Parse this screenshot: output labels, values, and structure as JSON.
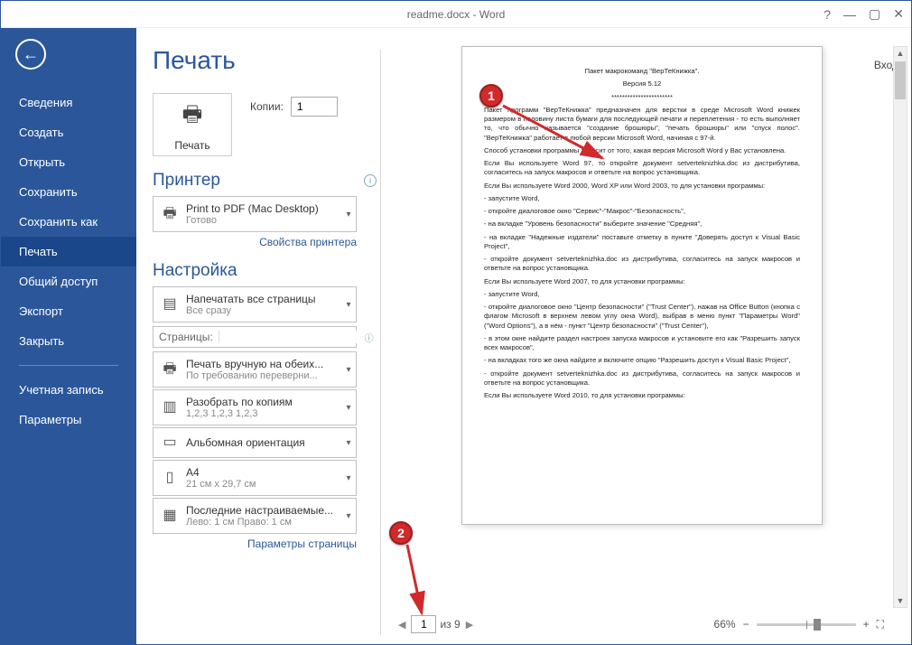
{
  "title": "readme.docx - Word",
  "signin": "Вход",
  "nav": {
    "items": [
      "Сведения",
      "Создать",
      "Открыть",
      "Сохранить",
      "Сохранить как",
      "Печать",
      "Общий доступ",
      "Экспорт",
      "Закрыть"
    ],
    "account": "Учетная запись",
    "options": "Параметры",
    "active_index": 5
  },
  "page": {
    "title": "Печать",
    "print_button": "Печать",
    "copies_label": "Копии:",
    "copies_value": "1",
    "printer_heading": "Принтер",
    "printer": {
      "name": "Print to PDF (Mac Desktop)",
      "status": "Готово"
    },
    "printer_props": "Свойства принтера",
    "settings_heading": "Настройка",
    "pages_label": "Страницы:",
    "page_settings_link": "Параметры страницы",
    "options": {
      "range": {
        "l1": "Напечатать все страницы",
        "l2": "Все сразу"
      },
      "duplex": {
        "l1": "Печать вручную на обеих...",
        "l2": "По требованию переверни..."
      },
      "collate": {
        "l1": "Разобрать по копиям",
        "l2": "1,2,3   1,2,3   1,2,3"
      },
      "orientation": {
        "l1": "Альбомная ориентация",
        "l2": ""
      },
      "size": {
        "l1": "A4",
        "l2": "21 см x 29,7 см"
      },
      "margins": {
        "l1": "Последние настраиваемые...",
        "l2": "Лево: 1 см   Право: 1 см"
      }
    }
  },
  "preview": {
    "current_page": "1",
    "total_pages_label": "из 9",
    "zoom": "66%",
    "doc": {
      "title": "Пакет макрокоманд \"ВерТеКнижка\".",
      "version": "Версия 5.12",
      "sep": "***********************",
      "p1": "Пакет программ \"ВерТеКнижка\" предназначен для верстки в среде Microsoft Word книжек размером в половину листа бумаги для последующей печати и переплетения - то есть выполняет то, что обычно называется \"создание брошюры\", \"печать брошюры\" или \"спуск полос\". \"ВерТеКнижка\" работает в любой версии Microsoft Word, начиная с 97-й.",
      "p2": "Способ установки программы зависит от того, какая версия Microsoft Word у Вас установлена.",
      "p3": "Если Вы используете Word 97, то откройте документ setverteknizhka.doc из дистрибутива, согласитесь на запуск макросов и ответьте на вопрос установщика.",
      "p4": "Если Вы используете Word 2000, Word XP или Word 2003, то для установки программы:",
      "p5": "- запустите Word,",
      "p6": "- откройте диалоговое окно \"Сервис\"-\"Макрос\"-\"Безопасность\",",
      "p7": "- на вкладке \"Уровень безопасности\" выберите значение \"Средняя\",",
      "p8": "- на вкладке \"Надежные издатели\" поставьте отметку в пункте \"Доверять доступ к Visual Basic Project\",",
      "p9": "- откройте документ setverteknizhka.doc из дистрибутива, согласитесь на запуск макросов и ответьте на вопрос установщика.",
      "p10": "Если Вы используете Word 2007, то для установки программы:",
      "p11": "- запустите Word,",
      "p12": "- откройте диалоговое окно \"Центр безопасности\" (\"Trust Center\"), нажав на Office Button (кнопка с флагом Microsoft в верхнем левом углу окна Word), выбрав в меню пункт \"Параметры Word\" (\"Word Options\"), а в нём - пункт \"Центр безопасности\" (\"Trust Center\"),",
      "p13": "- в этом окне найдите раздел настроек запуска макросов и установите его как \"Разрешить запуск всех макросов\",",
      "p14": "- на вкладках того же окна найдите и включите опцию \"Разрешить доступ к Visual Basic Project\",",
      "p15": "- откройте документ setverteknizhka.doc из дистрибутива, согласитесь на запуск макросов и ответьте на вопрос установщика.",
      "p16": "Если Вы используете Word 2010, то для установки программы:"
    }
  },
  "callouts": {
    "one": "1",
    "two": "2"
  }
}
